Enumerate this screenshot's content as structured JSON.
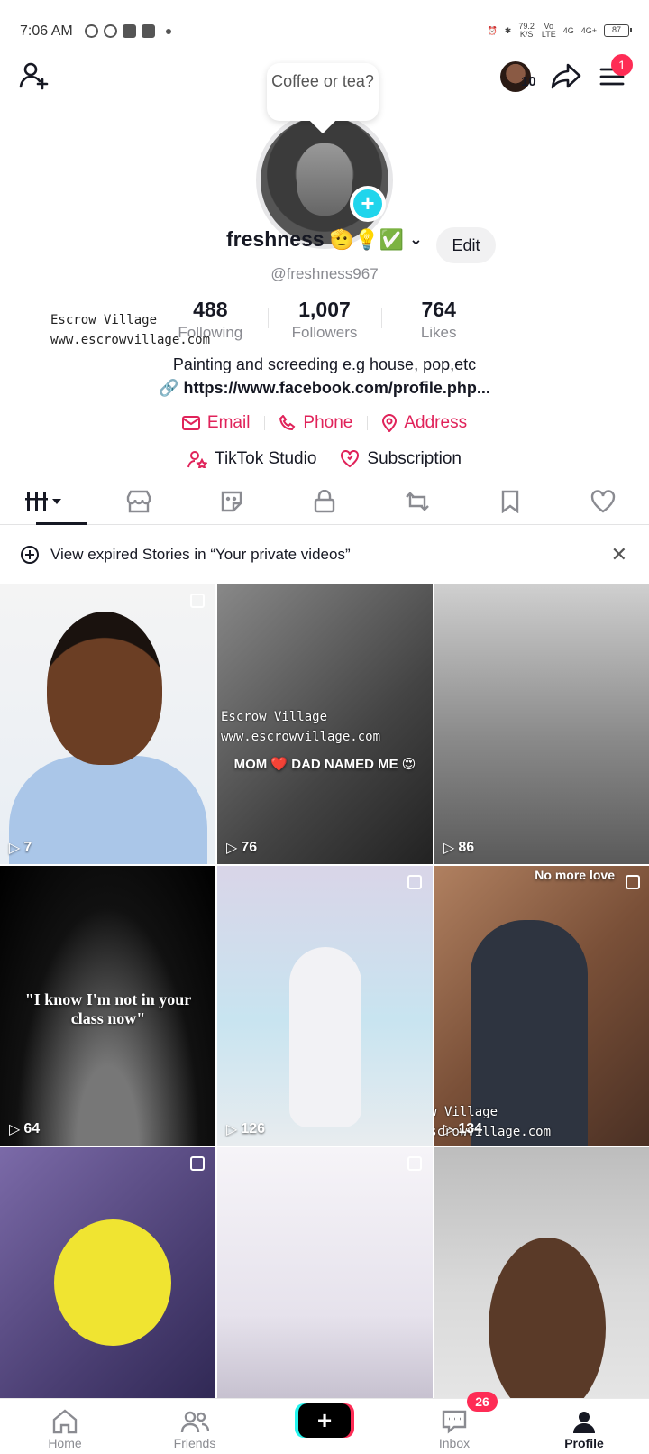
{
  "status_bar": {
    "time": "7:06 AM",
    "net_speed": "79.2",
    "net_unit": "K/S",
    "volte": "Vo",
    "lte": "LTE",
    "sig1": "4G",
    "sig2": "4G+",
    "battery": "87"
  },
  "header": {
    "avatar_count": "10",
    "menu_badge": "1",
    "note": "Coffee or tea?"
  },
  "profile": {
    "username": "freshness",
    "emojis": "🫡💡✅",
    "edit_label": "Edit",
    "handle": "@freshness967",
    "stats": [
      {
        "value": "488",
        "label": "Following"
      },
      {
        "value": "1,007",
        "label": "Followers"
      },
      {
        "value": "764",
        "label": "Likes"
      }
    ],
    "bio": "Painting and screeding e.g house, pop,etc",
    "link": "https://www.facebook.com/profile.php...",
    "contacts": [
      "Email",
      "Phone",
      "Address"
    ],
    "tools": [
      "TikTok Studio",
      "Subscription"
    ]
  },
  "watermark": {
    "line1": "Escrow Village",
    "line2": "www.escrowvillage.com"
  },
  "stories_bar": {
    "text": "View expired Stories in “Your private videos”"
  },
  "videos": [
    {
      "views": "7",
      "caption": ""
    },
    {
      "views": "76",
      "caption": "MOM ❤️ DAD NAMED ME 😍"
    },
    {
      "views": "86",
      "caption": ""
    },
    {
      "views": "64",
      "caption": "\"I know I'm not in your class now\""
    },
    {
      "views": "126",
      "caption": ""
    },
    {
      "views": "134",
      "caption": "No more love"
    },
    {
      "views": "",
      "caption": ""
    },
    {
      "views": "",
      "caption": ""
    },
    {
      "views": "",
      "caption": ""
    }
  ],
  "bottom_nav": {
    "items": [
      "Home",
      "Friends",
      "",
      "Inbox",
      "Profile"
    ],
    "inbox_badge": "26"
  },
  "colors": {
    "accent_red": "#fe2c55",
    "link_pink": "#e0235a",
    "cyan": "#20d5ec"
  }
}
